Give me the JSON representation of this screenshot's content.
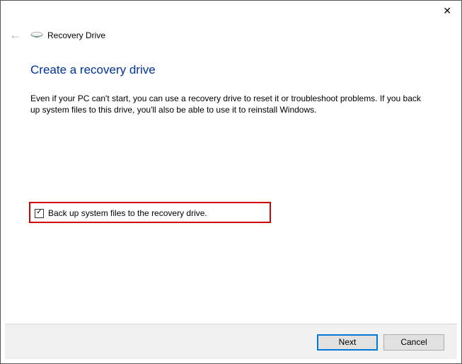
{
  "window": {
    "title": "Recovery Drive"
  },
  "page": {
    "heading": "Create a recovery drive",
    "description": "Even if your PC can't start, you can use a recovery drive to reset it or troubleshoot problems. If you back up system files to this drive, you'll also be able to use it to reinstall Windows."
  },
  "checkbox": {
    "label": "Back up system files to the recovery drive.",
    "checked": true
  },
  "buttons": {
    "next": "Next",
    "cancel": "Cancel"
  }
}
